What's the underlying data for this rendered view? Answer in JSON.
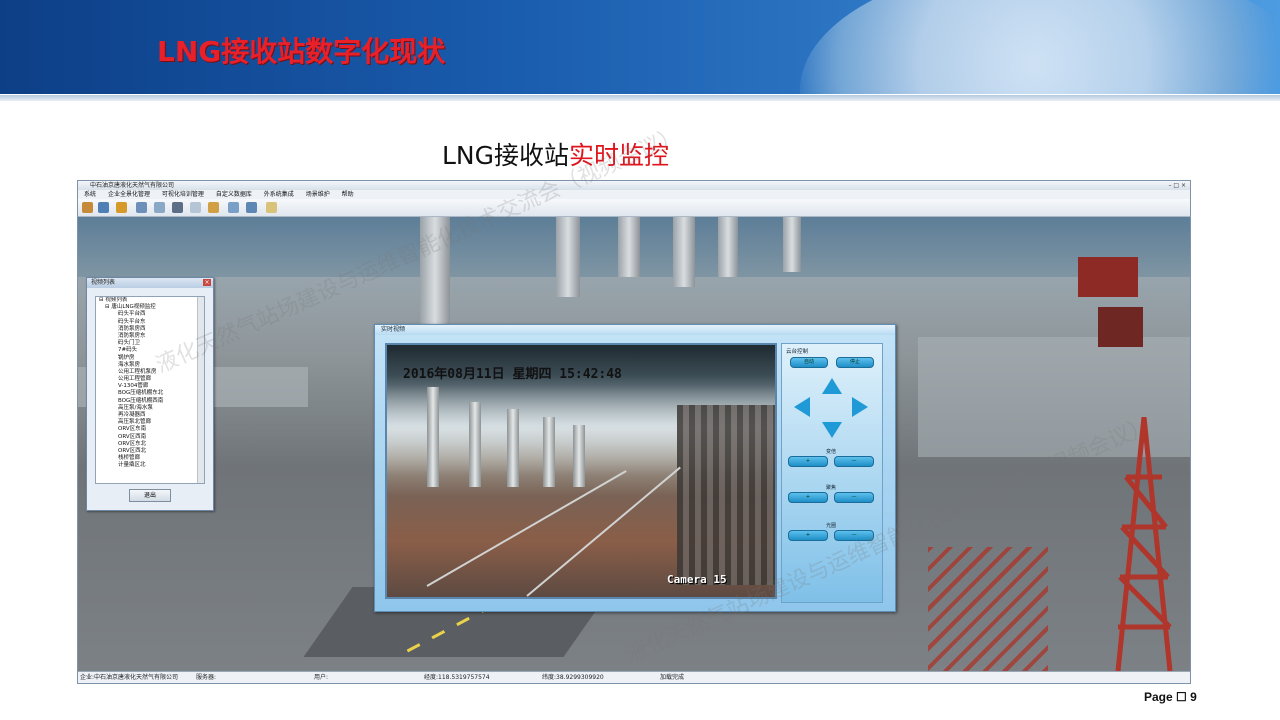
{
  "slide": {
    "title": "LNG接收站数字化现状",
    "subtitle_black": "LNG接收站",
    "subtitle_red": "实时监控",
    "page_label": "Page",
    "page_number": "9"
  },
  "app": {
    "window_title": "中石油京唐液化天然气有限公司",
    "window_controls": "– □ ×",
    "menu": [
      "系统",
      "企业全景化管理",
      "可视化培训管理",
      "自定义数据库",
      "外系统集成",
      "场景维护",
      "帮助"
    ],
    "statusbar": {
      "company": "企业:中石油京唐液化天然气有限公司",
      "server": "服务器:",
      "user": "用户:",
      "longitude": "经度:118.5319757574",
      "latitude": "纬度:38.9299309920",
      "load_status": "加载完成"
    }
  },
  "video_list": {
    "title": "视频列表",
    "close": "×",
    "root": "视频列表",
    "group": "唐山LNG视频监控",
    "items": [
      "码头平台西",
      "码头平台东",
      "消防泵房西",
      "消防泵房东",
      "码头门卫",
      "7#码头",
      "锅炉房",
      "海水泵房",
      "公用工程机泵房",
      "公用工程管廊",
      "V-1304管廊",
      "BOG压缩机棚东北",
      "BOG压缩机棚西南",
      "高压泵/海水泵",
      "再冷凝器西",
      "高压泵北管廊",
      "ORV区东南",
      "ORV区西南",
      "ORV区东北",
      "ORV区西北",
      "栈桥管廊",
      "计量撬区北"
    ],
    "exit_button": "退出"
  },
  "monitor": {
    "title": "实时视频",
    "osd_datetime": "2016年08月11日  星期四  15:42:48",
    "osd_camera": "Camera 15",
    "ptz": {
      "title": "云台控制",
      "btn_auto": "自动",
      "btn_stop": "停止",
      "zoom_label": "变倍",
      "focus_label": "聚焦",
      "iris_label": "光圈",
      "plus": "+",
      "minus": "—"
    }
  },
  "watermark": "液化天然气站场建设与运维智能化技术交流会（视频会议）",
  "colors": {
    "title_red": "#e8202a",
    "banner_blue": "#1a5cae"
  }
}
